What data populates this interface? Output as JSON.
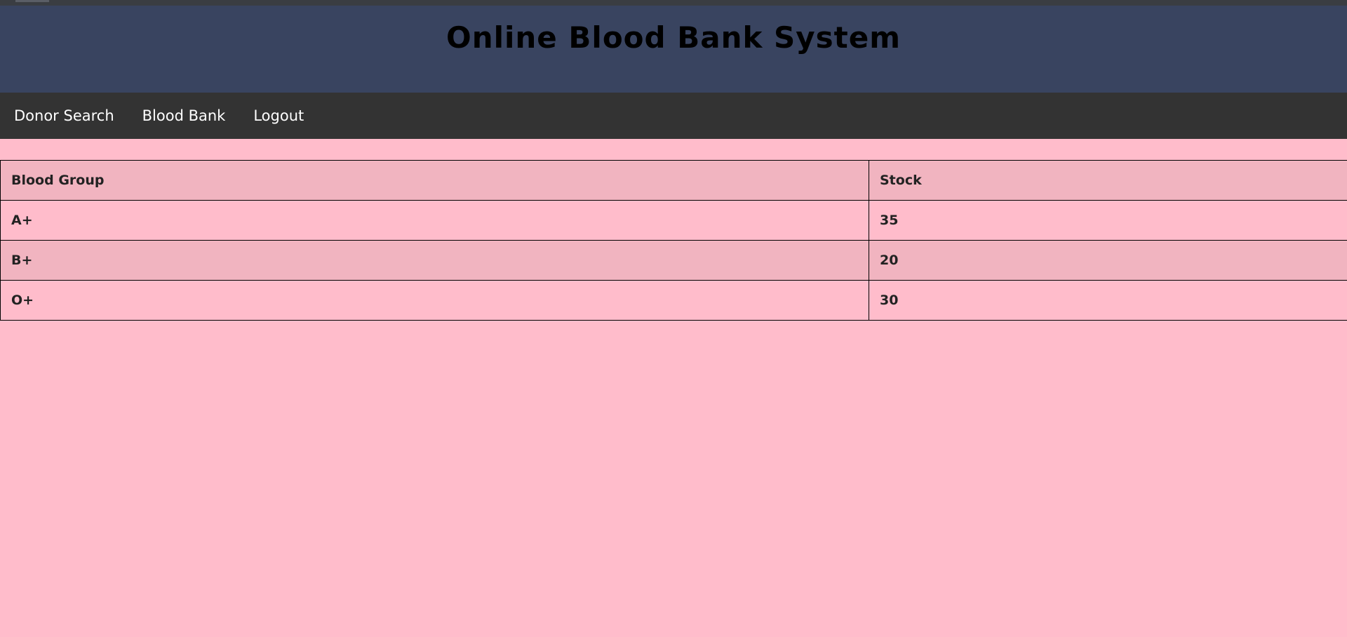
{
  "header": {
    "title": "Online Blood Bank System"
  },
  "nav": {
    "items": [
      {
        "label": "Donor Search"
      },
      {
        "label": "Blood Bank"
      },
      {
        "label": "Logout"
      }
    ]
  },
  "table": {
    "headers": [
      "Blood Group",
      "Stock"
    ],
    "rows": [
      [
        "A+",
        "35"
      ],
      [
        "B+",
        "20"
      ],
      [
        "O+",
        "30"
      ]
    ]
  },
  "colors": {
    "header_bg": "#394460",
    "nav_bg": "#333333",
    "page_bg": "#ffbccb",
    "stripe_bg": "#f1b4c0"
  }
}
